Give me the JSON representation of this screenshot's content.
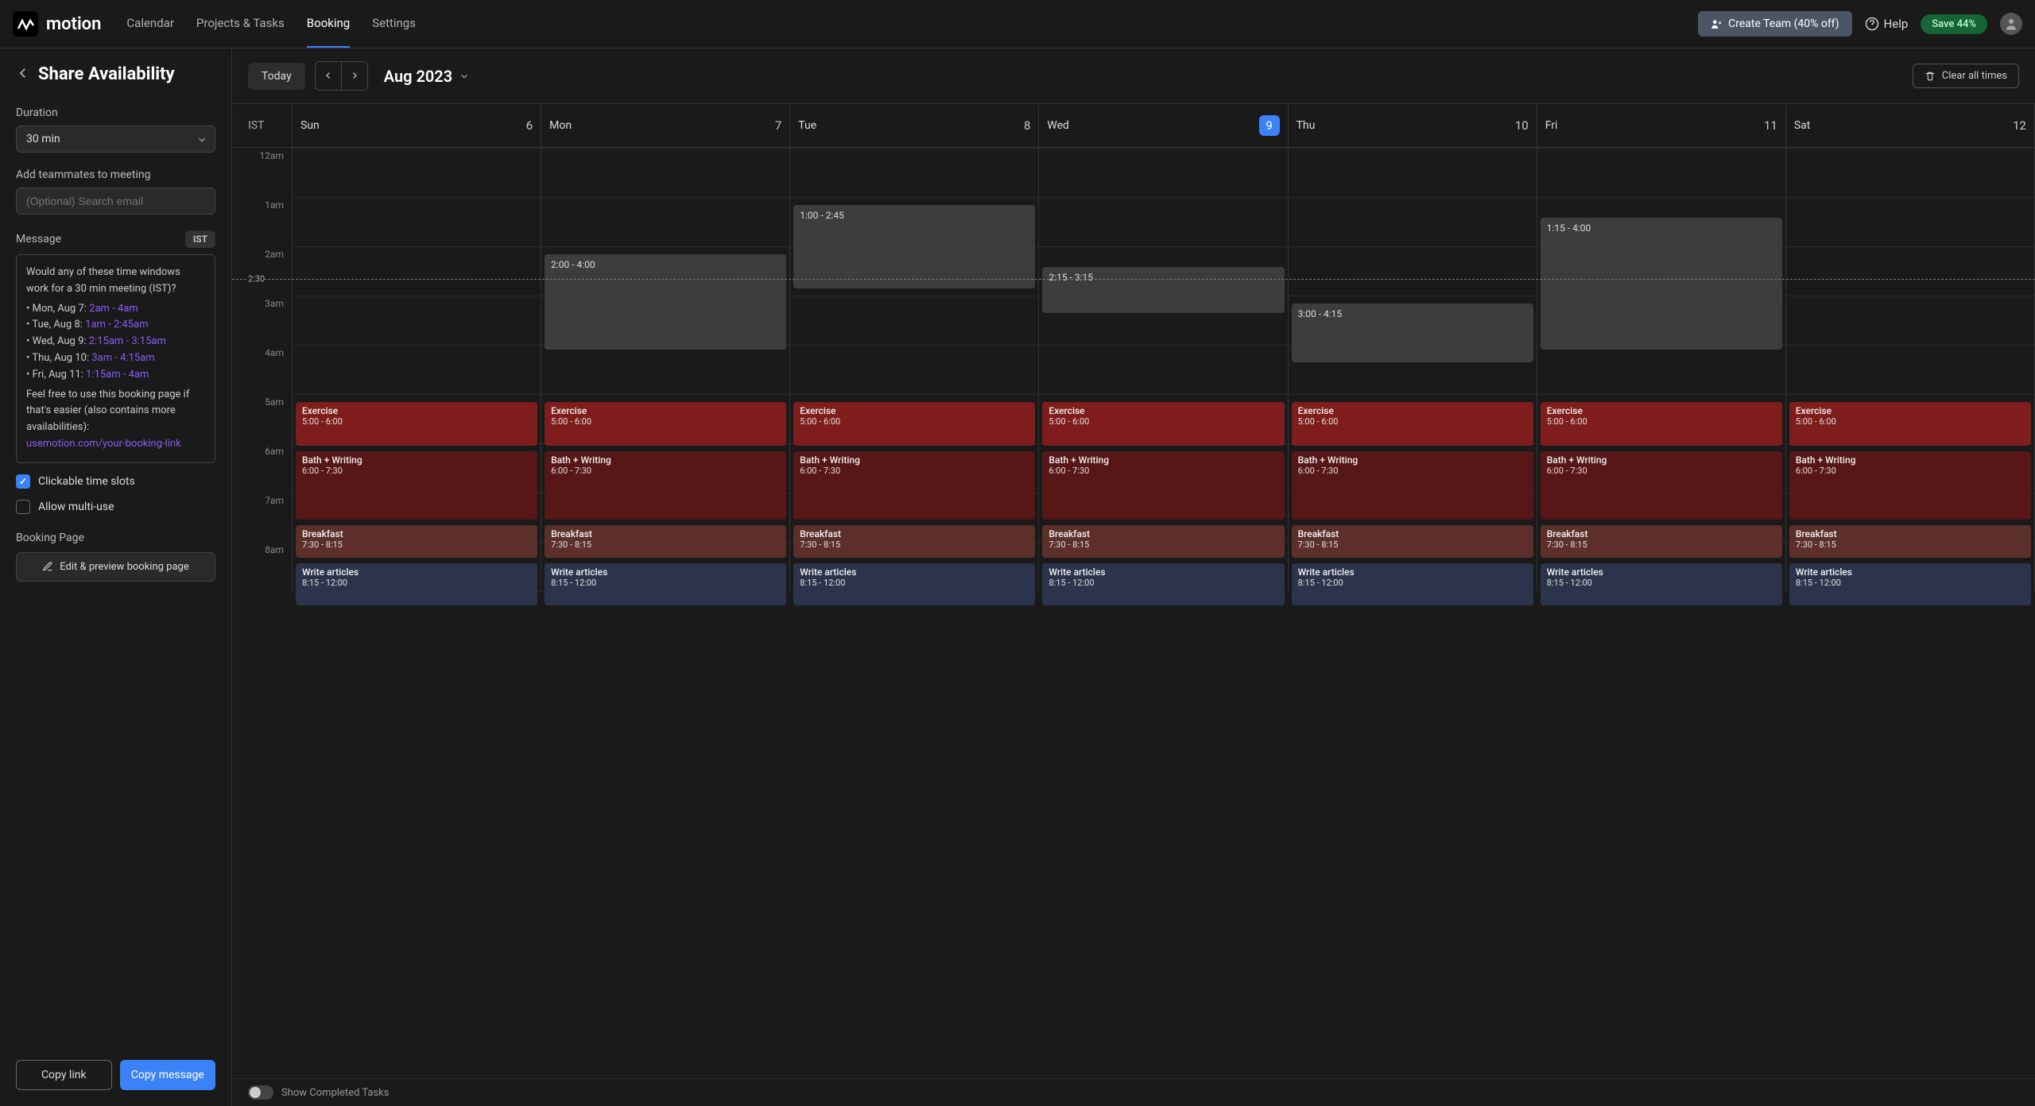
{
  "brand": "motion",
  "nav": {
    "items": [
      "Calendar",
      "Projects & Tasks",
      "Booking",
      "Settings"
    ],
    "active_idx": 2
  },
  "topbar": {
    "create_team": "Create Team (40% off)",
    "help": "Help",
    "save_badge": "Save 44%"
  },
  "sidebar": {
    "title": "Share Availability",
    "duration_label": "Duration",
    "duration_value": "30 min",
    "add_teammates_label": "Add teammates to meeting",
    "search_placeholder": "(Optional) Search email",
    "message_label": "Message",
    "tz_badge": "IST",
    "msg": {
      "intro": "Would any of these time windows work for a 30 min meeting (IST)?",
      "bullets": [
        {
          "day": "Mon, Aug 7: ",
          "range": "2am - 4am"
        },
        {
          "day": "Tue, Aug 8: ",
          "range": "1am - 2:45am"
        },
        {
          "day": "Wed, Aug 9: ",
          "range": "2:15am - 3:15am"
        },
        {
          "day": "Thu, Aug 10: ",
          "range": "3am - 4:15am"
        },
        {
          "day": "Fri, Aug 11: ",
          "range": "1:15am - 4am"
        }
      ],
      "outro": "Feel free to use this booking page if that's easier (also contains more availabilities):",
      "link": "usemotion.com/your-booking-link"
    },
    "clickable_label": "Clickable time slots",
    "clickable_checked": true,
    "multi_label": "Allow multi-use",
    "multi_checked": false,
    "booking_page_label": "Booking Page",
    "edit_btn": "Edit & preview booking page",
    "copy_link": "Copy link",
    "copy_message": "Copy message"
  },
  "calendar": {
    "today_btn": "Today",
    "month": "Aug 2023",
    "clear_btn": "Clear all times",
    "tz": "IST",
    "days": [
      {
        "name": "Sun",
        "num": "6",
        "today": false
      },
      {
        "name": "Mon",
        "num": "7",
        "today": false
      },
      {
        "name": "Tue",
        "num": "8",
        "today": false
      },
      {
        "name": "Wed",
        "num": "9",
        "today": true
      },
      {
        "name": "Thu",
        "num": "10",
        "today": false
      },
      {
        "name": "Fri",
        "num": "11",
        "today": false
      },
      {
        "name": "Sat",
        "num": "12",
        "today": false
      }
    ],
    "hours": [
      "12am",
      "1am",
      "2am",
      "3am",
      "4am",
      "5am",
      "6am",
      "7am",
      "8am"
    ],
    "now_label": "2:30",
    "now_hour_frac": 2.5,
    "slots": [
      {
        "day": 1,
        "label": "2:00 - 4:00",
        "start": 2.0,
        "end": 4.0
      },
      {
        "day": 2,
        "label": "1:00 - 2:45",
        "start": 1.0,
        "end": 2.75
      },
      {
        "day": 3,
        "label": "2:15 - 3:15",
        "start": 2.25,
        "end": 3.25
      },
      {
        "day": 4,
        "label": "3:00 - 4:15",
        "start": 3.0,
        "end": 4.25
      },
      {
        "day": 5,
        "label": "1:15 - 4:00",
        "start": 1.25,
        "end": 4.0
      }
    ],
    "event_templates": [
      {
        "title": "Exercise",
        "sub": "5:00 - 6:00",
        "cls": "ev-red",
        "start": 5.0,
        "end": 5.95
      },
      {
        "title": "Bath + Writing",
        "sub": "6:00 - 7:30",
        "cls": "ev-darkred",
        "start": 6.0,
        "end": 7.45
      },
      {
        "title": "Breakfast",
        "sub": "7:30 - 8:15",
        "cls": "ev-brown",
        "start": 7.5,
        "end": 8.22
      },
      {
        "title": "Write articles",
        "sub": "8:15 - 12:00",
        "cls": "ev-blue",
        "start": 8.27,
        "end": 9.2
      }
    ],
    "footer_toggle": "Show Completed Tasks"
  }
}
